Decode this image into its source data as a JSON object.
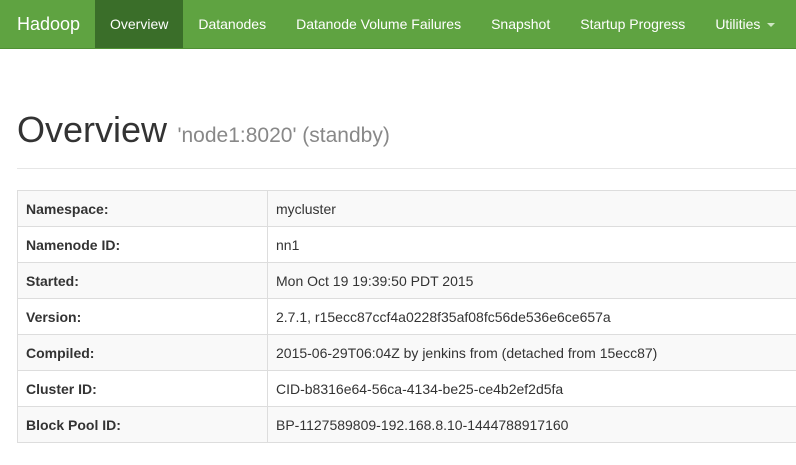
{
  "navbar": {
    "brand": "Hadoop",
    "items": [
      {
        "label": "Overview",
        "active": true
      },
      {
        "label": "Datanodes",
        "active": false
      },
      {
        "label": "Datanode Volume Failures",
        "active": false
      },
      {
        "label": "Snapshot",
        "active": false
      },
      {
        "label": "Startup Progress",
        "active": false
      },
      {
        "label": "Utilities",
        "active": false,
        "dropdown": true
      }
    ]
  },
  "header": {
    "title": "Overview",
    "subtitle": "'node1:8020' (standby)"
  },
  "overview_table": [
    {
      "key": "Namespace:",
      "value": "mycluster"
    },
    {
      "key": "Namenode ID:",
      "value": "nn1"
    },
    {
      "key": "Started:",
      "value": "Mon Oct 19 19:39:50 PDT 2015"
    },
    {
      "key": "Version:",
      "value": "2.7.1, r15ecc87ccf4a0228f35af08fc56de536e6ce657a"
    },
    {
      "key": "Compiled:",
      "value": "2015-06-29T06:04Z by jenkins from (detached from 15ecc87)"
    },
    {
      "key": "Cluster ID:",
      "value": "CID-b8316e64-56ca-4134-be25-ce4b2ef2d5fa"
    },
    {
      "key": "Block Pool ID:",
      "value": "BP-1127589809-192.168.8.10-1444788917160"
    }
  ],
  "colors": {
    "navbar": "#5fa341",
    "navbar_active": "#3a6e29"
  }
}
